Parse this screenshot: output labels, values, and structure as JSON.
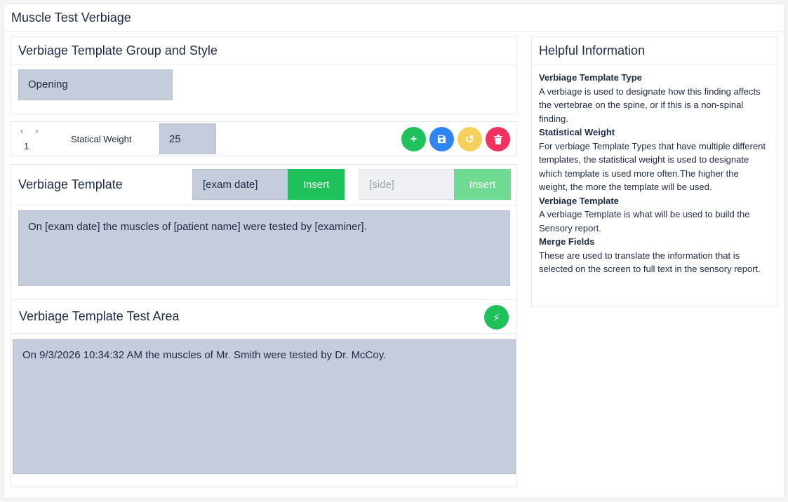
{
  "app": {
    "title": "Muscle Test Verbiage"
  },
  "group_card": {
    "title": "Verbiage Template Group and Style",
    "group_value": "Opening"
  },
  "toolbar": {
    "prev_icon": "‹",
    "next_icon": "›",
    "page": "1",
    "weight_label": "Statical Weight",
    "weight_value": "25",
    "buttons": {
      "add": {
        "icon": "+",
        "color": "#1fc25a"
      },
      "save": {
        "icon": "💾",
        "color": "#2d86f3"
      },
      "reset": {
        "icon": "↺",
        "color": "#f6d05c"
      },
      "delete": {
        "icon": "🗑",
        "color": "#f0335e"
      }
    }
  },
  "template_card": {
    "title": "Verbiage Template",
    "merge_field_1": "[exam date]",
    "insert_1": "Insert",
    "merge_field_2": "[side]",
    "insert_2": "Insert",
    "template_text": "On [exam date] the muscles of [patient name] were tested by [examiner]."
  },
  "test_area": {
    "title": "Verbiage Template Test Area",
    "run_icon": "⚡",
    "output_text": "On 9/3/2026 10:34:32 AM the muscles of Mr. Smith were tested by Dr. McCoy."
  },
  "help": {
    "title": "Helpful Information",
    "sections": [
      {
        "heading": "Verbiage Template Type",
        "body": "A verbiage is used to designate how this finding affects the vertebrae on the spine, or if this is a non-spinal finding."
      },
      {
        "heading": "Statistical Weight",
        "body": "For verbiage Template Types that have multiple different templates, the statistical weight is used to designate which template is used more often.The higher the weight, the more the template will be used."
      },
      {
        "heading": "Verbiage Template",
        "body": "A verbiage Template is what will be used to build the Sensory report."
      },
      {
        "heading": "Merge Fields",
        "body": "These are used to translate the information that is selected on the screen to full text in the sensory report."
      }
    ]
  }
}
